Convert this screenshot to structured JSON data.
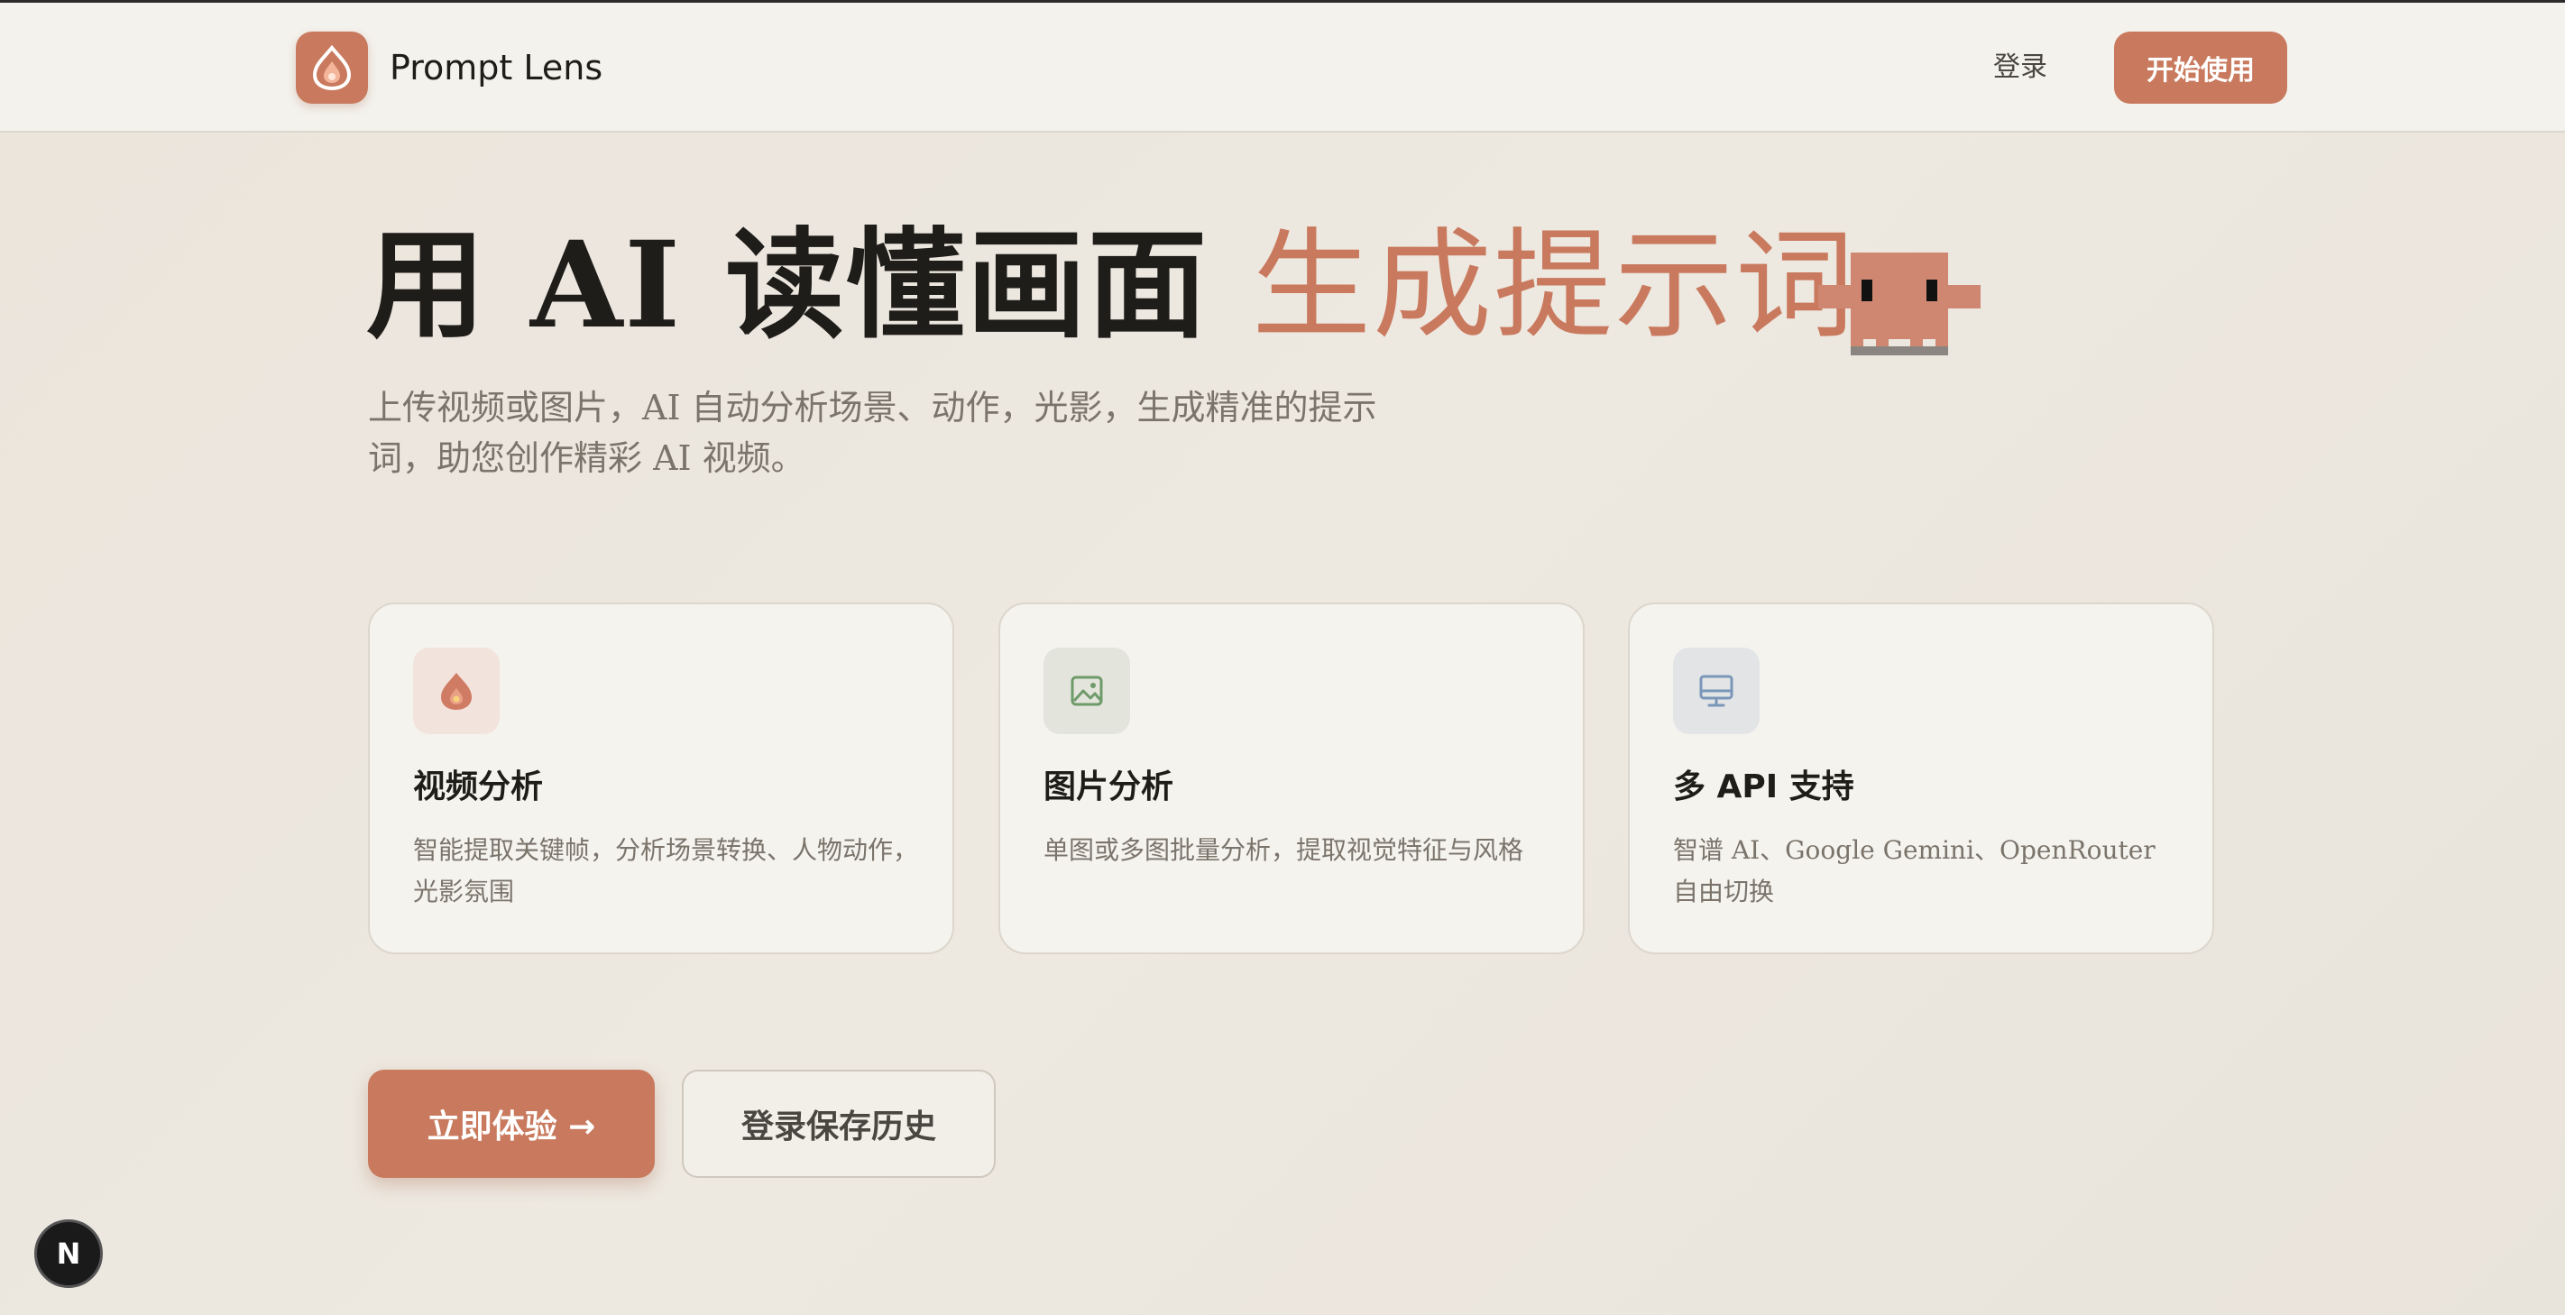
{
  "header": {
    "app_name": "Prompt Lens",
    "login_label": "登录",
    "start_label": "开始使用"
  },
  "hero": {
    "title_main": "用 AI 读懂画面 ",
    "title_accent": "生成提示词",
    "subtitle": "上传视频或图片，AI 自动分析场景、动作，光影，生成精准的提示词，助您创作精彩 AI 视频。"
  },
  "features": [
    {
      "icon": "flame-icon",
      "title": "视频分析",
      "desc": "智能提取关键帧，分析场景转换、人物动作，光影氛围"
    },
    {
      "icon": "image-icon",
      "title": "图片分析",
      "desc": "单图或多图批量分析，提取视觉特征与风格"
    },
    {
      "icon": "monitor-icon",
      "title": "多 API 支持",
      "desc": "智谱 AI、Google Gemini、OpenRouter 自由切换"
    }
  ],
  "cta": {
    "primary_label": "立即体验 →",
    "secondary_label": "登录保存历史"
  },
  "dev_badge": {
    "label": "N"
  },
  "colors": {
    "accent": "#c97a5e",
    "background": "#ece7df",
    "card_bg": "#f5f3ee",
    "text_muted": "#7a746b"
  }
}
